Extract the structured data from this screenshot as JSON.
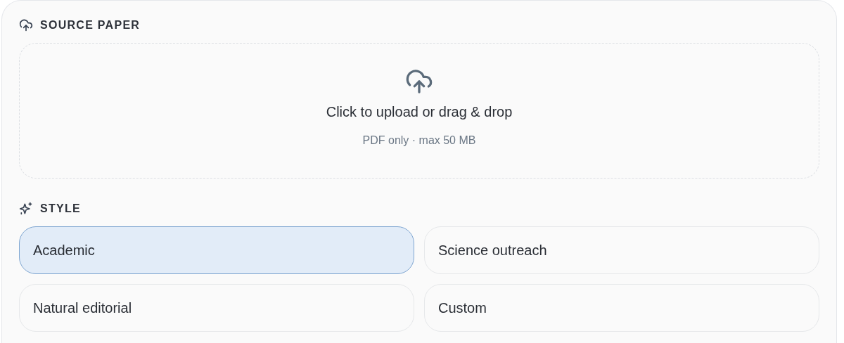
{
  "source": {
    "heading": "SOURCE PAPER",
    "upload": {
      "title": "Click to upload or drag & drop",
      "hint": "PDF only · max 50 MB"
    }
  },
  "style": {
    "heading": "STYLE",
    "options": [
      {
        "label": "Academic",
        "selected": true
      },
      {
        "label": "Science outreach",
        "selected": false
      },
      {
        "label": "Natural editorial",
        "selected": false
      },
      {
        "label": "Custom",
        "selected": false
      }
    ]
  }
}
